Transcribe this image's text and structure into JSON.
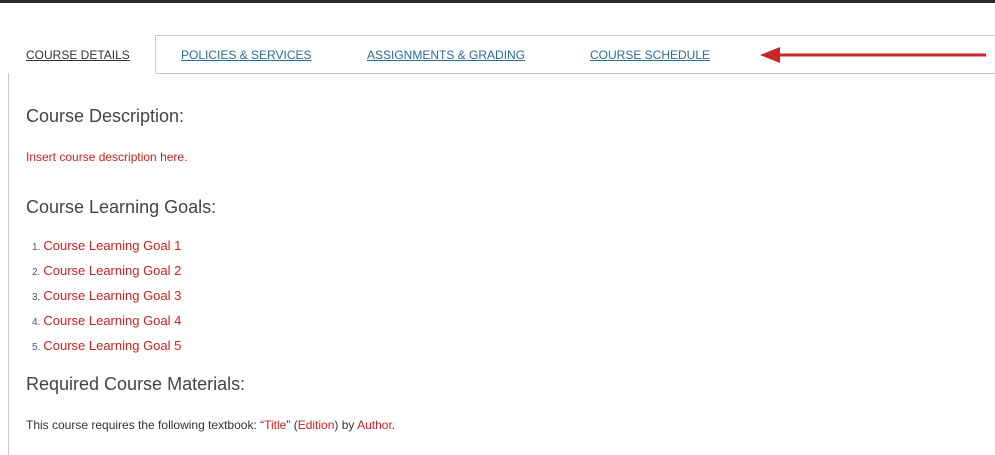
{
  "tabs": [
    {
      "label": "COURSE DETAILS",
      "active": true
    },
    {
      "label": "POLICIES & SERVICES",
      "active": false
    },
    {
      "label": "ASSIGNMENTS & GRADING",
      "active": false
    },
    {
      "label": "COURSE SCHEDULE",
      "active": false
    }
  ],
  "annotation": {
    "icon": "left-arrow-icon",
    "color": "#c62828"
  },
  "sections": {
    "description": {
      "heading": "Course Description:",
      "text": "Insert course description here."
    },
    "goals": {
      "heading": "Course Learning Goals:",
      "items": [
        {
          "num": "1.",
          "label": "Course Learning Goal 1"
        },
        {
          "num": "2.",
          "label": "Course Learning Goal 2"
        },
        {
          "num": "3.",
          "label": "Course Learning Goal 3"
        },
        {
          "num": "4.",
          "label": "Course Learning Goal 4"
        },
        {
          "num": "5.",
          "label": "Course Learning Goal 5"
        }
      ]
    },
    "materials": {
      "heading": "Required Course Materials:",
      "prefix": "This course requires the following textbook: “",
      "title": "Title",
      "mid1": "” (",
      "edition": "Edition",
      "mid2": ") by ",
      "author": "Author",
      "suffix": "."
    }
  },
  "colors": {
    "link": "#2a6b9c",
    "placeholder_red": "#cc1f1f",
    "border": "#c8c8c8"
  }
}
